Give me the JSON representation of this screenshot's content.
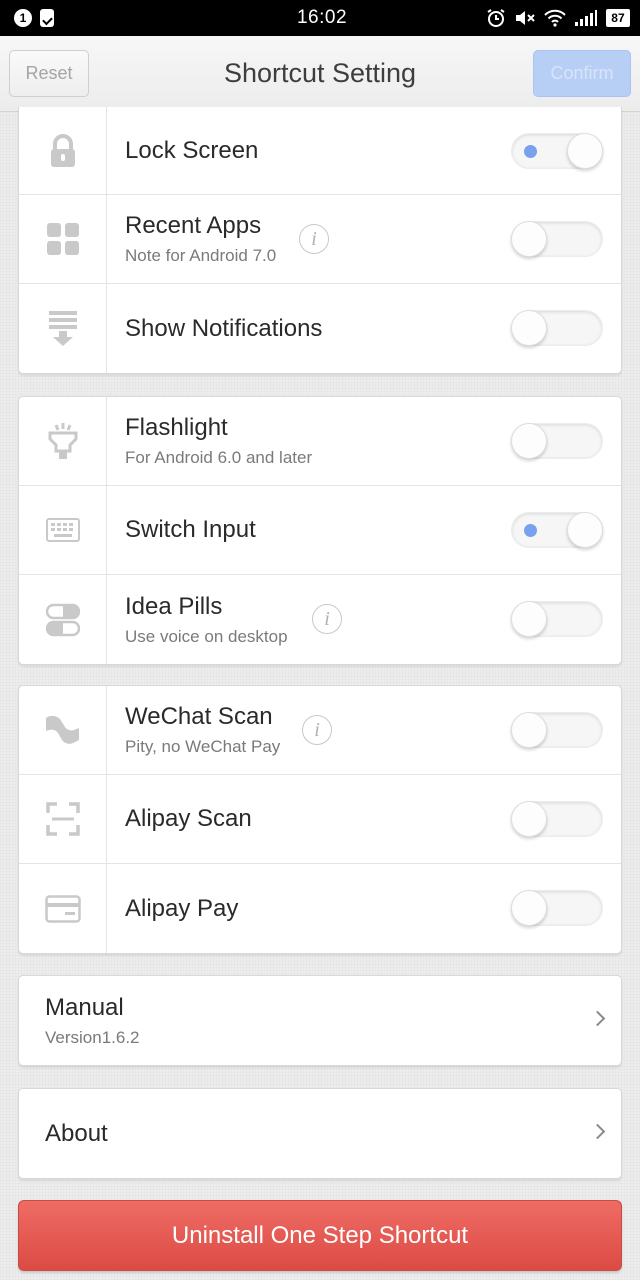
{
  "status_bar": {
    "notification_count": "1",
    "time": "16:02",
    "battery": "87",
    "icons": [
      "notification-badge-icon",
      "clipboard-check-icon",
      "alarm-icon",
      "mute-icon",
      "wifi-icon",
      "signal-icon",
      "battery-icon"
    ]
  },
  "header": {
    "title": "Shortcut Setting",
    "reset_label": "Reset",
    "confirm_label": "Confirm"
  },
  "group1": [
    {
      "icon": "lock-icon",
      "title": "Lock Screen",
      "subtitle": "",
      "info": false,
      "enabled": true
    },
    {
      "icon": "grid-apps-icon",
      "title": "Recent Apps",
      "subtitle": "Note for Android 7.0",
      "info": true,
      "enabled": false
    },
    {
      "icon": "notification-drop-icon",
      "title": "Show Notifications",
      "subtitle": "",
      "info": false,
      "enabled": false
    }
  ],
  "group2": [
    {
      "icon": "flashlight-icon",
      "title": "Flashlight",
      "subtitle": "For Android 6.0 and later",
      "info": false,
      "enabled": false
    },
    {
      "icon": "keyboard-icon",
      "title": "Switch Input",
      "subtitle": "",
      "info": false,
      "enabled": true
    },
    {
      "icon": "pills-icon",
      "title": "Idea Pills",
      "subtitle": "Use voice on desktop",
      "info": true,
      "enabled": false
    }
  ],
  "group3": [
    {
      "icon": "wechat-scan-icon",
      "title": "WeChat Scan",
      "subtitle": "Pity, no WeChat Pay",
      "info": true,
      "enabled": false
    },
    {
      "icon": "scan-frame-icon",
      "title": "Alipay Scan",
      "subtitle": "",
      "info": false,
      "enabled": false
    },
    {
      "icon": "card-icon",
      "title": "Alipay Pay",
      "subtitle": "",
      "info": false,
      "enabled": false
    }
  ],
  "manual": {
    "title": "Manual",
    "subtitle": "Version1.6.2"
  },
  "about": {
    "title": "About"
  },
  "uninstall_label": "Uninstall One Step Shortcut",
  "colors": {
    "toggle_on_dot": "#7aa1ee",
    "uninstall": "#e55a53",
    "confirm": "#b8cff5"
  }
}
